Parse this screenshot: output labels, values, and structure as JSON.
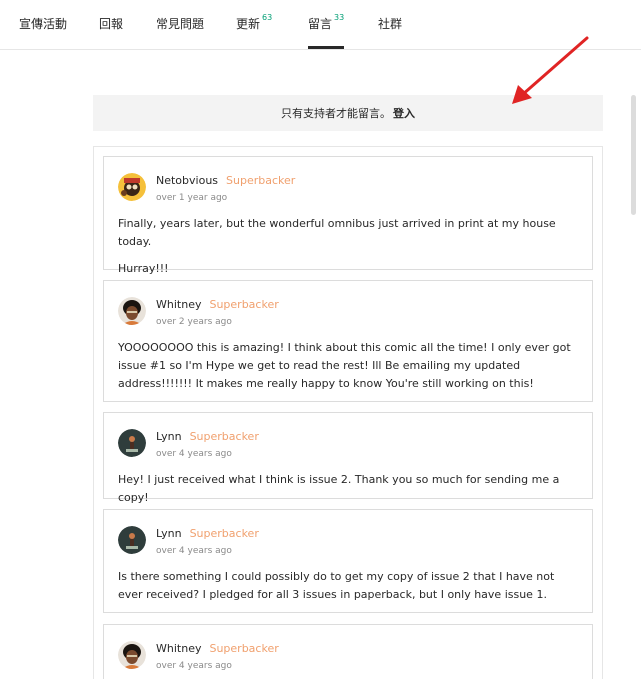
{
  "tabs": [
    {
      "label": "宣傳活動",
      "count": ""
    },
    {
      "label": "回報",
      "count": ""
    },
    {
      "label": "常見問題",
      "count": ""
    },
    {
      "label": "更新",
      "count": "63"
    },
    {
      "label": "留言",
      "count": "33"
    },
    {
      "label": "社群",
      "count": ""
    }
  ],
  "active_tab": "留言",
  "login_bar": {
    "message": "只有支持者才能留言。",
    "link": "登入"
  },
  "comments": [
    {
      "author": "Netobvious",
      "badge": "Superbacker",
      "time": "over 1 year ago",
      "paragraphs": [
        "Finally, years later, but the wonderful omnibus just arrived in print at my house today.",
        "Hurray!!!"
      ]
    },
    {
      "author": "Whitney",
      "badge": "Superbacker",
      "time": "over 2 years ago",
      "paragraphs": [
        "YOOOOOOOO this is amazing! I think about this comic all the time! I only ever got issue #1 so I'm Hype we get to read the rest! Ill Be emailing my updated address!!!!!!! It makes me really happy to know You're still working on this!"
      ]
    },
    {
      "author": "Lynn",
      "badge": "Superbacker",
      "time": "over 4 years ago",
      "paragraphs": [
        "Hey! I just received what I think is issue 2. Thank you so much for sending me a copy!"
      ]
    },
    {
      "author": "Lynn",
      "badge": "Superbacker",
      "time": "over 4 years ago",
      "paragraphs": [
        "Is there something I could possibly do to get my copy of issue 2 that I have not ever received? I pledged for all 3 issues in paperback, but I only have issue 1."
      ]
    },
    {
      "author": "Whitney",
      "badge": "Superbacker",
      "time": "over 4 years ago",
      "paragraphs": []
    }
  ],
  "colors": {
    "badge": "#f0a06e",
    "count": "#009e74",
    "arrow": "#e02424",
    "login_bar_bg": "#f3f3f3"
  }
}
